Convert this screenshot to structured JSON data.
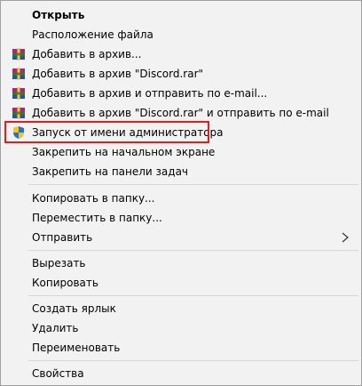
{
  "menu": {
    "items": [
      {
        "label": "Открыть",
        "icon": ""
      },
      {
        "label": "Расположение файла",
        "icon": ""
      },
      {
        "label": "Добавить в архив...",
        "icon": "winrar-archive-icon"
      },
      {
        "label": "Добавить в архив \"Discord.rar\"",
        "icon": "winrar-archive-icon"
      },
      {
        "label": "Добавить в архив и отправить по e-mail...",
        "icon": "winrar-archive-icon"
      },
      {
        "label": "Добавить в архив \"Discord.rar\" и отправить по e-mail",
        "icon": "winrar-archive-icon"
      },
      {
        "label": "Запуск от имени администратора",
        "icon": "uac-shield-icon"
      },
      {
        "label": "Закрепить на начальном экране",
        "icon": ""
      },
      {
        "label": "Закрепить на панели задач",
        "icon": ""
      },
      {
        "label": "Копировать в папку...",
        "icon": ""
      },
      {
        "label": "Переместить в папку...",
        "icon": ""
      },
      {
        "label": "Отправить",
        "icon": "chevron-right-icon"
      },
      {
        "label": "Вырезать",
        "icon": ""
      },
      {
        "label": "Копировать",
        "icon": ""
      },
      {
        "label": "Создать ярлык",
        "icon": ""
      },
      {
        "label": "Удалить",
        "icon": ""
      },
      {
        "label": "Переименовать",
        "icon": ""
      },
      {
        "label": "Свойства",
        "icon": ""
      }
    ]
  },
  "colors": {
    "highlight_border": "#e31c1c",
    "menu_background": "#f2f2f2",
    "separator": "#d7d7d7"
  }
}
